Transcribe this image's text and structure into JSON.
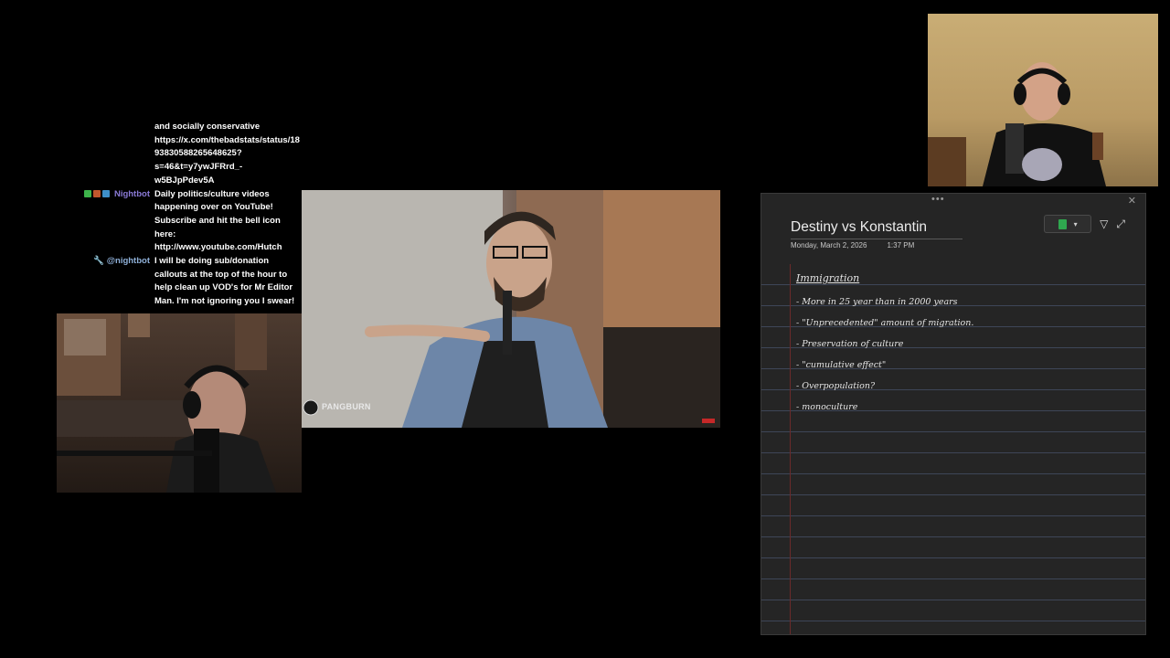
{
  "chat": {
    "messages": [
      {
        "user": "",
        "text": "and socially conservative https://x.com/thebadstats/status/1893830588265648625?s=46&t=y7ywJFRrd_-w5BJpPdev5A",
        "badges": []
      },
      {
        "user": "Nightbot",
        "text": "Daily politics/culture videos happening over on YouTube! Subscribe and hit the bell icon here: http://www.youtube.com/Hutch",
        "badges": [
          "#3db34a",
          "#c1572d",
          "#3e8fc9"
        ]
      },
      {
        "user": "@nightbot",
        "text": "I will be doing sub/donation callouts at the top of the hour to help clean up VOD's for Mr Editor Man. I'm not ignoring you I swear!",
        "badges": [
          "wrench-icon"
        ]
      }
    ]
  },
  "video": {
    "watermark": "PANGBURN"
  },
  "notes": {
    "title": "Destiny vs Konstantin",
    "date": "Monday, March 2, 2026",
    "time": "1:37 PM",
    "heading": "Immigration",
    "items": [
      "- More in 25 year than in 2000 years",
      "- \"Unprecedented\" amount of migration.",
      "- Preservation of culture",
      "- \"cumulative effect\"",
      "- Overpopulation?",
      "- monoculture"
    ],
    "notebook_color": "#2fa84f"
  }
}
